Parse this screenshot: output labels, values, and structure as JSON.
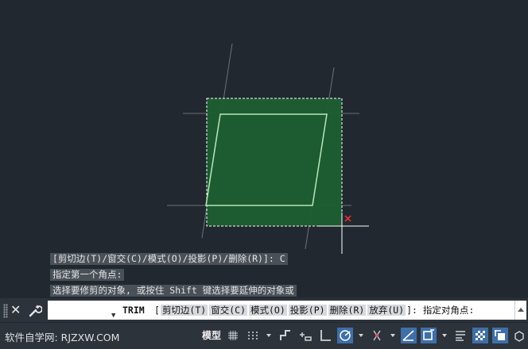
{
  "command_history": [
    "[剪切边(T)/窗交(C)/模式(O)/投影(P)/删除(R)]: C",
    "指定第一个角点:",
    "选择要修剪的对象, 或按住 Shift 键选择要延伸的对象或"
  ],
  "command_line": {
    "command": "TRIM",
    "open_bracket": "[",
    "options": [
      "剪切边(T)",
      "窗交(C)",
      "模式(O)",
      "投影(P)",
      "删除(R)",
      "放弃(U)"
    ],
    "prompt": "]: 指定对角点:"
  },
  "status_bar": {
    "brand": "软件自学网: RJZXW.COM",
    "model_tab": "模型"
  },
  "colors": {
    "background": "#212830",
    "selection_fill": "#1d5e30",
    "selection_border": "#ffffff",
    "shape_stroke": "#b8e6b8",
    "toggle_on": "#3e6fa8"
  }
}
